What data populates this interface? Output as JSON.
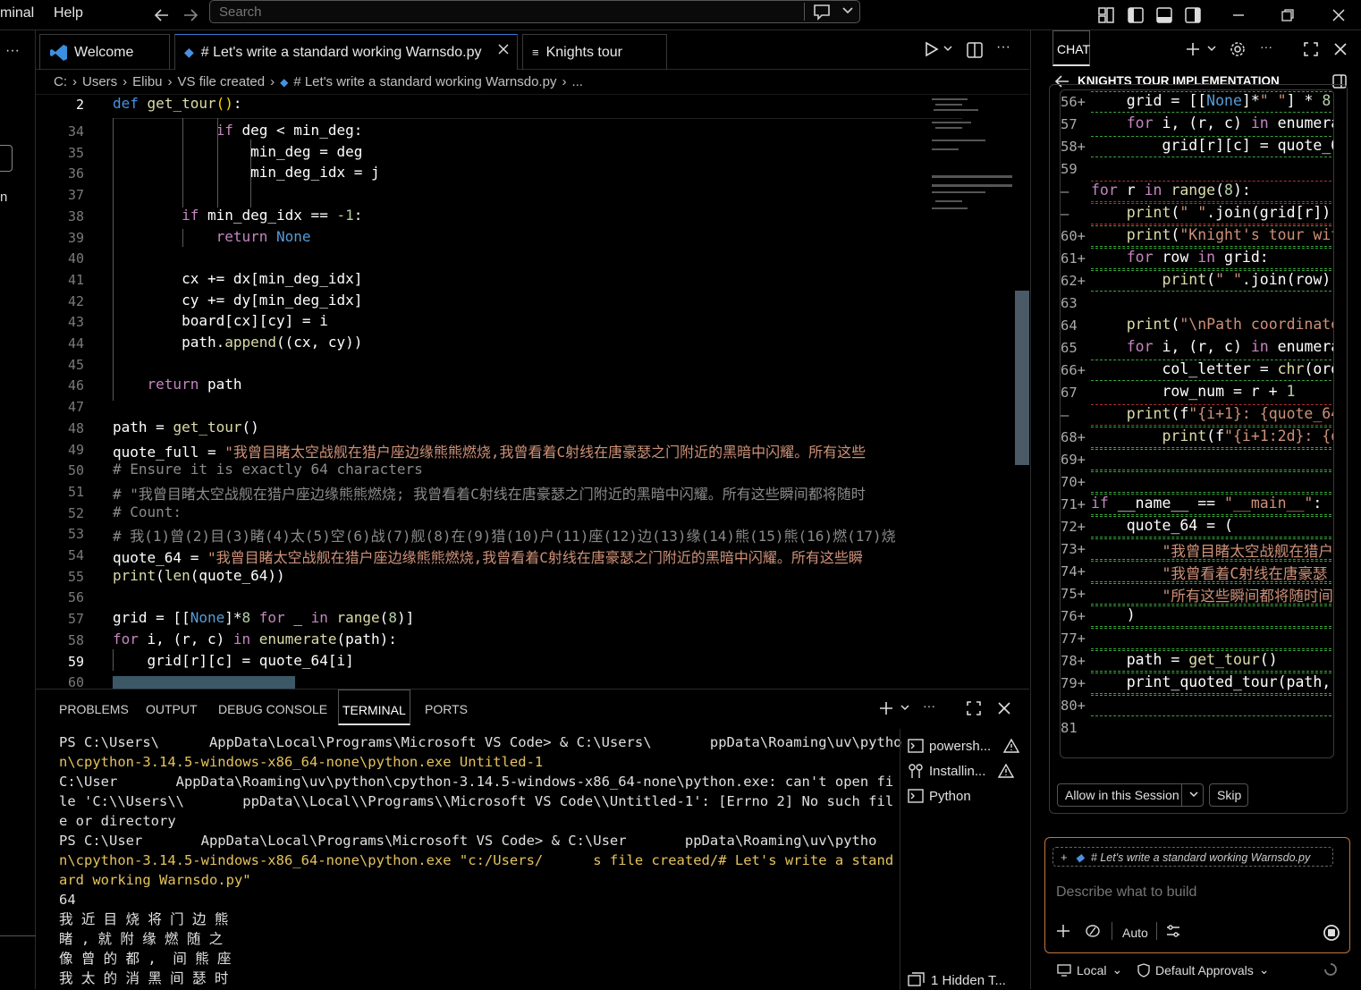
{
  "menu": {
    "terminal": "minal",
    "help": "Help"
  },
  "search": {
    "placeholder": "Search"
  },
  "tabs": [
    {
      "label": "Welcome"
    },
    {
      "label": "# Let's write a standard working Warnsdo.py"
    },
    {
      "label": "Knights tour"
    }
  ],
  "breadcrumb": [
    "C:",
    "Users",
    "Elibu",
    "VS file created",
    "# Let's write a standard working Warnsdo.py",
    "..."
  ],
  "editor": {
    "sticky_line_num": "2",
    "sticky_line": "def get_tour():",
    "line_numbers": [
      "34",
      "35",
      "36",
      "37",
      "38",
      "39",
      "40",
      "41",
      "42",
      "43",
      "44",
      "45",
      "46",
      "47",
      "48",
      "49",
      "50",
      "51",
      "52",
      "53",
      "54",
      "55",
      "56",
      "57",
      "58",
      "59",
      "60"
    ],
    "lines": [
      "            if deg < min_deg:",
      "                min_deg = deg",
      "                min_deg_idx = j",
      "",
      "        if min_deg_idx == -1:",
      "            return None",
      "",
      "        cx += dx[min_deg_idx]",
      "        cy += dy[min_deg_idx]",
      "        board[cx][cy] = i",
      "        path.append((cx, cy))",
      "",
      "    return path",
      "",
      "path = get_tour()",
      "quote_full = \"我曾目睹太空战舰在猎户座边缘熊熊燃烧,我曾看着C射线在唐豪瑟之门附近的黑暗中闪耀。所有这些",
      "# Ensure it is exactly 64 characters",
      "# \"我曾目睹太空战舰在猎户座边缘熊熊燃烧; 我曾看着C射线在唐豪瑟之门附近的黑暗中闪耀。所有这些瞬间都将随时",
      "# Count:",
      "# 我(1)曾(2)目(3)睹(4)太(5)空(6)战(7)舰(8)在(9)猎(10)户(11)座(12)边(13)缘(14)熊(15)熊(16)燃(17)烧",
      "quote_64 = \"我曾目睹太空战舰在猎户座边缘熊熊燃烧,我曾看着C射线在唐豪瑟之门附近的黑暗中闪耀。所有这些瞬",
      "print(len(quote_64))",
      "",
      "grid = [[None]*8 for _ in range(8)]",
      "for i, (r, c) in enumerate(path):",
      "    grid[r][c] = quote_64[i]",
      ""
    ]
  },
  "panel": {
    "tabs": [
      "PROBLEMS",
      "OUTPUT",
      "DEBUG CONSOLE",
      "TERMINAL",
      "PORTS"
    ],
    "terminal_lines": [
      "PS C:\\Users\\      AppData\\Local\\Programs\\Microsoft VS Code> & C:\\Users\\       ppData\\Roaming\\uv\\pytho",
      "n\\cpython-3.14.5-windows-x86_64-none\\python.exe Untitled-1",
      "C:\\User       AppData\\Roaming\\uv\\python\\cpython-3.14.5-windows-x86_64-none\\python.exe: can't open fi",
      "le 'C:\\\\Users\\\\       ppData\\\\Local\\\\Programs\\\\Microsoft VS Code\\\\Untitled-1': [Errno 2] No such fil",
      "e or directory",
      "PS C:\\User       AppData\\Local\\Programs\\Microsoft VS Code> & C:\\User       ppData\\Roaming\\uv\\pytho",
      "n\\cpython-3.14.5-windows-x86_64-none\\python.exe \"c:/Users/      s file created/# Let's write a stand",
      "ard working Warnsdo.py\"",
      "64",
      "我 近 目 烧 将 门 边 熊",
      "睹 , 就 附 缘 燃 随 之",
      "像 曾 的 都 ,  间 熊 座",
      "我 太 的 消 黑 间 瑟 时"
    ],
    "terminal_list": [
      "powersh...",
      "Installin...",
      "Python"
    ],
    "hidden_terminals": "1 Hidden T..."
  },
  "chat": {
    "tab": "CHAT",
    "title": "KNIGHTS TOUR IMPLEMENTATION",
    "code_lines": [
      {
        "n": "56+",
        "t": "    grid = [[None]*\" \"] * 8"
      },
      {
        "n": "57",
        "t": "    for i, (r, c) in enumerat"
      },
      {
        "n": "58+",
        "t": "        grid[r][c] = quote_64"
      },
      {
        "n": "59",
        "t": ""
      },
      {
        "n": "",
        "t": "for r in range(8):"
      },
      {
        "n": "",
        "t": "    print(\" \".join(grid[r]))"
      },
      {
        "n": "60+",
        "t": "    print(\"Knight's tour with"
      },
      {
        "n": "61+",
        "t": "    for row in grid:"
      },
      {
        "n": "62+",
        "t": "        print(\" \".join(row))"
      },
      {
        "n": "63",
        "t": ""
      },
      {
        "n": "64",
        "t": "    print(\"\\nPath coordinates"
      },
      {
        "n": "65",
        "t": "    for i, (r, c) in enumerat"
      },
      {
        "n": "66+",
        "t": "        col_letter = chr(ord"
      },
      {
        "n": "67",
        "t": "        row_num = r + 1"
      },
      {
        "n": "",
        "t": "    print(f\"{i+1}: {quote_64"
      },
      {
        "n": "68+",
        "t": "        print(f\"{i+1:2d}: {qu"
      },
      {
        "n": "69+",
        "t": ""
      },
      {
        "n": "70+",
        "t": ""
      },
      {
        "n": "71+",
        "t": "if __name__ == \"__main__\":"
      },
      {
        "n": "72+",
        "t": "    quote_64 = ("
      },
      {
        "n": "73+",
        "t": "        \"我曾目睹太空战舰在猎户"
      },
      {
        "n": "74+",
        "t": "        \"我曾看着C射线在唐豪瑟"
      },
      {
        "n": "75+",
        "t": "        \"所有这些瞬间都将随时间"
      },
      {
        "n": "76+",
        "t": "    )"
      },
      {
        "n": "77+",
        "t": ""
      },
      {
        "n": "78+",
        "t": "    path = get_tour()"
      },
      {
        "n": "79+",
        "t": "    print_quoted_tour(path, q"
      },
      {
        "n": "80+",
        "t": ""
      },
      {
        "n": "81",
        "t": ""
      }
    ],
    "allow_label": "Allow in this Session",
    "skip_label": "Skip",
    "context_chip": "# Let's write a standard working Warnsdo.py",
    "input_placeholder": "Describe what to build",
    "mode": "Auto",
    "footer_local": "Local",
    "footer_approvals": "Default Approvals"
  },
  "colors": {
    "accent": "#3a7bd5",
    "chat_border": "#c0763c",
    "added": "#3aa63a",
    "removed": "#b03030"
  }
}
